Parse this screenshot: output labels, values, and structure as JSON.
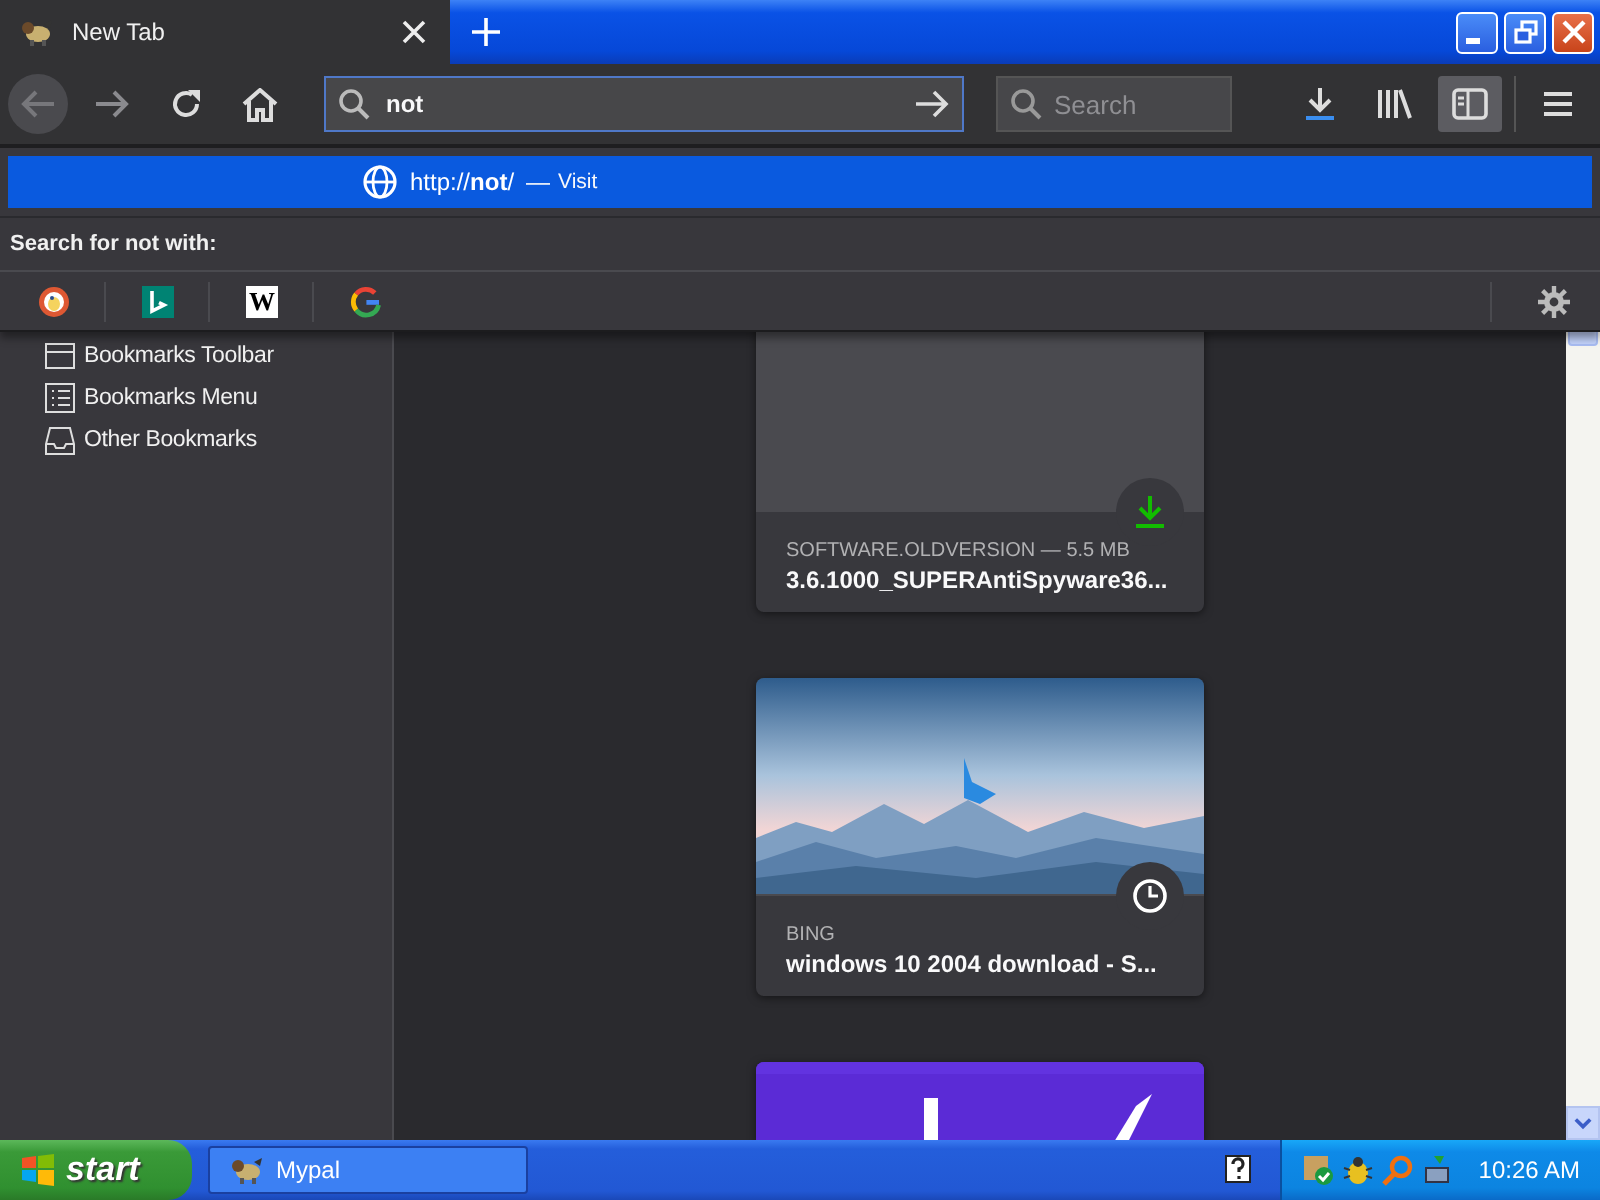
{
  "tab": {
    "title": "New Tab",
    "selected": true
  },
  "toolbar": {
    "address": {
      "value": "not"
    },
    "search": {
      "placeholder": "Search"
    },
    "sidebar_toggle": {
      "selected": true
    }
  },
  "url_popup": {
    "visit_row": {
      "url": "http://**not**/",
      "separator": "—",
      "action": "Visit",
      "selected": true
    },
    "search_label": "Search for not with:",
    "engines": [
      {
        "kind": "duckduckgo"
      },
      {
        "kind": "bing"
      },
      {
        "kind": "wikipedia",
        "glyph": "W"
      },
      {
        "kind": "google"
      }
    ]
  },
  "sidebar": {
    "items": [
      {
        "kind": "toolbar",
        "label": "Bookmarks Toolbar"
      },
      {
        "kind": "menu",
        "label": "Bookmarks Menu"
      },
      {
        "kind": "other",
        "label": "Other Bookmarks"
      }
    ]
  },
  "cards": [
    {
      "kind": "download",
      "source": "SOFTWARE.OLDVERSION — 5.5 MB",
      "title": "3.6.1000_SUPERAntiSpyware36..."
    },
    {
      "kind": "history",
      "source": "BING",
      "title": "windows 10 2004 download - S..."
    },
    {
      "kind": "preview"
    }
  ],
  "taskbar": {
    "start": "start",
    "tasks": [
      {
        "label": "Mypal",
        "selected": false
      }
    ],
    "clock": "10:26 AM"
  }
}
